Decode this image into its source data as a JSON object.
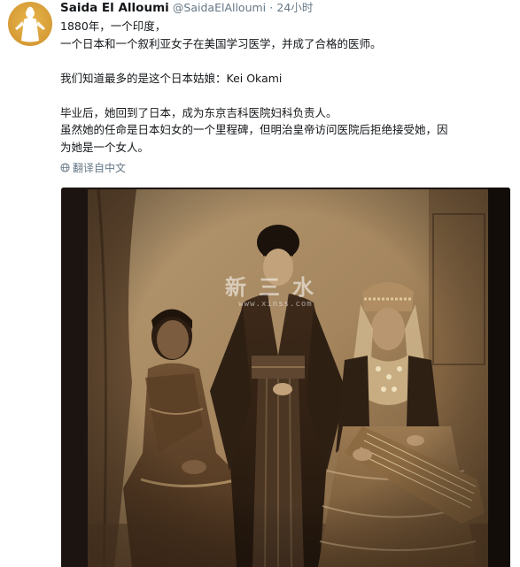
{
  "tweet": {
    "display_name": "Saida El Alloumi",
    "handle": "@SaidaElAlloumi",
    "separator": "·",
    "time": "24小时",
    "lines": [
      "1880年，一个印度，",
      "一个日本和一个叙利亚女子在美国学习医学，并成了合格的医师。",
      "我们知道最多的是这个日本姑娘：Kei Okami",
      "毕业后，她回到了日本，成为东京吉科医院妇科负责人。",
      "虽然她的任命是日本妇女的一个里程碑，但明治皇帝访问医院后拒绝接受她，因",
      "为她是一个女人。"
    ],
    "translate_label": "翻译自中文"
  },
  "photo": {
    "watermark_main": "新三水",
    "watermark_url": "www.xinss.com"
  },
  "colors": {
    "text": "#14171a",
    "muted": "#657786",
    "avatar_bg": "#d9a03a",
    "photo_sepia": "#8a6a45"
  },
  "icons": {
    "translate": "globe-icon",
    "avatar": "user-avatar"
  }
}
